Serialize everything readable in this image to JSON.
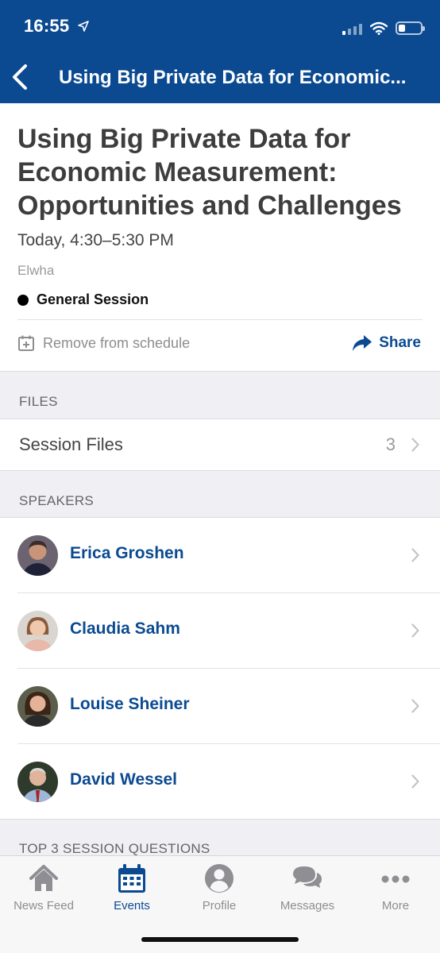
{
  "status_bar": {
    "time": "16:55"
  },
  "nav": {
    "title": "Using Big Private Data for Economic..."
  },
  "event": {
    "title": "Using Big Private Data for Economic Measurement: Opportunities and Challenges",
    "time": "Today, 4:30–5:30 PM",
    "location": "Elwha",
    "track": "General Session",
    "remove_label": "Remove from schedule",
    "share_label": "Share"
  },
  "files_section": {
    "header": "FILES",
    "item_label": "Session Files",
    "item_count": "3"
  },
  "speakers_section": {
    "header": "SPEAKERS",
    "speakers": [
      {
        "name": "Erica Groshen"
      },
      {
        "name": "Claudia Sahm"
      },
      {
        "name": "Louise Sheiner"
      },
      {
        "name": "David Wessel"
      }
    ]
  },
  "questions_section": {
    "header": "TOP 3 SESSION QUESTIONS"
  },
  "tabbar": {
    "tabs": [
      {
        "label": "News Feed",
        "icon": "home-icon"
      },
      {
        "label": "Events",
        "icon": "calendar-icon",
        "active": true
      },
      {
        "label": "Profile",
        "icon": "profile-icon"
      },
      {
        "label": "Messages",
        "icon": "messages-icon"
      },
      {
        "label": "More",
        "icon": "more-icon"
      }
    ]
  },
  "colors": {
    "brand": "#0b4a91",
    "section_bg": "#efeff4"
  }
}
